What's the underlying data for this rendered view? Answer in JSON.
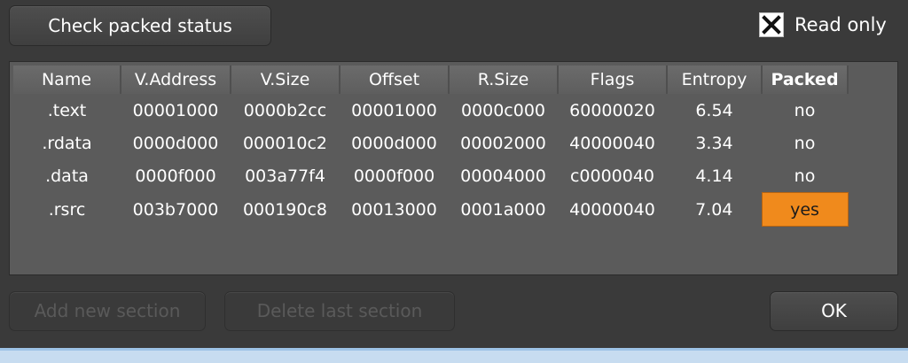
{
  "toolbar": {
    "check_label": "Check packed status",
    "readonly_label": "Read only",
    "readonly_checked": true
  },
  "table": {
    "headers": [
      "Name",
      "V.Address",
      "V.Size",
      "Offset",
      "R.Size",
      "Flags",
      "Entropy",
      "Packed"
    ],
    "rows": [
      [
        ".text",
        "00001000",
        "0000b2cc",
        "00001000",
        "0000c000",
        "60000020",
        "6.54",
        "no"
      ],
      [
        ".rdata",
        "0000d000",
        "000010c2",
        "0000d000",
        "00002000",
        "40000040",
        "3.34",
        "no"
      ],
      [
        ".data",
        "0000f000",
        "003a77f4",
        "0000f000",
        "00004000",
        "c0000040",
        "4.14",
        "no"
      ],
      [
        ".rsrc",
        "003b7000",
        "000190c8",
        "00013000",
        "0001a000",
        "40000040",
        "7.04",
        "yes"
      ]
    ]
  },
  "footer": {
    "add_label": "Add new section",
    "delete_label": "Delete last section",
    "ok_label": "OK"
  },
  "colors": {
    "background": "#3a3a3a",
    "table_bg": "#5b5b5b",
    "packed_highlight": "#f08a1c"
  },
  "icons": {
    "checkbox": "x-check-icon"
  }
}
